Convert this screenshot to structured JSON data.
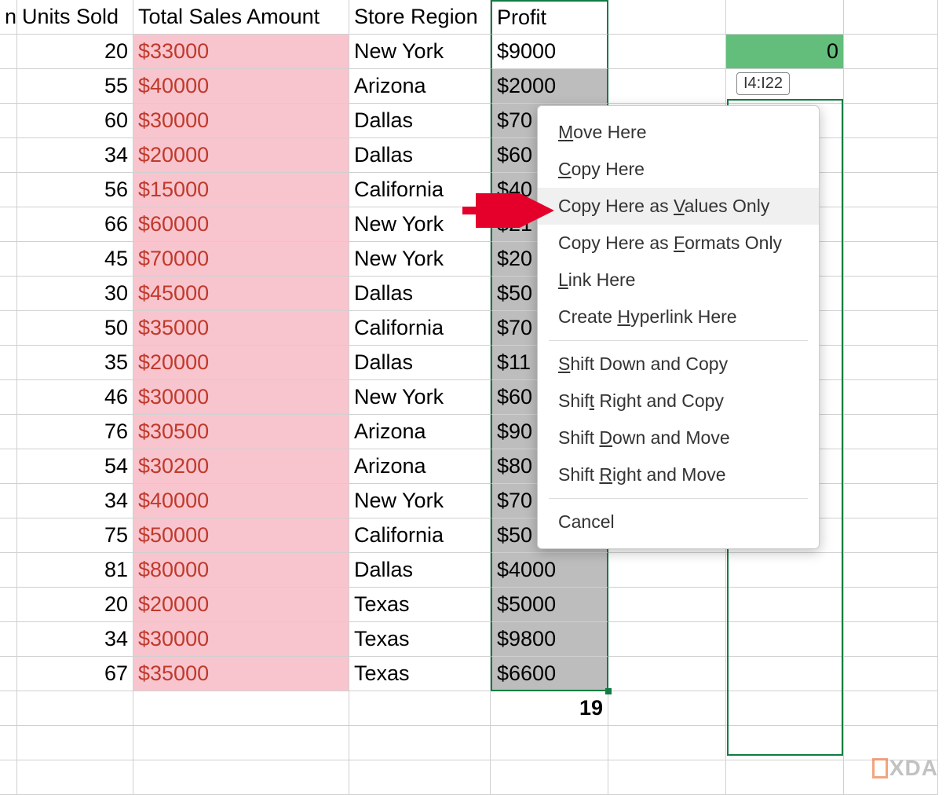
{
  "headers": {
    "partial": "n",
    "units_sold": "Units Sold",
    "total_sales": "Total Sales Amount",
    "store_region": "Store Region",
    "profit": "Profit"
  },
  "rows": [
    {
      "units": "20",
      "sales": "$33000",
      "region": "New York",
      "profit": "$9000"
    },
    {
      "units": "55",
      "sales": "$40000",
      "region": "Arizona",
      "profit": "$2000"
    },
    {
      "units": "60",
      "sales": "$30000",
      "region": "Dallas",
      "profit": "$70"
    },
    {
      "units": "34",
      "sales": "$20000",
      "region": "Dallas",
      "profit": "$60"
    },
    {
      "units": "56",
      "sales": "$15000",
      "region": "California",
      "profit": "$40"
    },
    {
      "units": "66",
      "sales": "$60000",
      "region": "New York",
      "profit": "$21"
    },
    {
      "units": "45",
      "sales": "$70000",
      "region": "New York",
      "profit": "$20"
    },
    {
      "units": "30",
      "sales": "$45000",
      "region": "Dallas",
      "profit": "$50"
    },
    {
      "units": "50",
      "sales": "$35000",
      "region": "California",
      "profit": "$70"
    },
    {
      "units": "35",
      "sales": "$20000",
      "region": "Dallas",
      "profit": "$11"
    },
    {
      "units": "46",
      "sales": "$30000",
      "region": "New York",
      "profit": "$60"
    },
    {
      "units": "76",
      "sales": "$30500",
      "region": "Arizona",
      "profit": "$90"
    },
    {
      "units": "54",
      "sales": "$30200",
      "region": "Arizona",
      "profit": "$80"
    },
    {
      "units": "34",
      "sales": "$40000",
      "region": "New York",
      "profit": "$70"
    },
    {
      "units": "75",
      "sales": "$50000",
      "region": "California",
      "profit": "$50"
    },
    {
      "units": "81",
      "sales": "$80000",
      "region": "Dallas",
      "profit": "$4000"
    },
    {
      "units": "20",
      "sales": "$20000",
      "region": "Texas",
      "profit": "$5000"
    },
    {
      "units": "34",
      "sales": "$30000",
      "region": "Texas",
      "profit": "$9800"
    },
    {
      "units": "67",
      "sales": "$35000",
      "region": "Texas",
      "profit": "$6600"
    }
  ],
  "dest_first_cell": "0",
  "count_cell": "19",
  "ref_tooltip": "I4:I22",
  "context_menu": {
    "move_here": "Move Here",
    "copy_here": "Copy Here",
    "copy_values": "Copy Here as Values Only",
    "copy_formats": "Copy Here as Formats Only",
    "link_here": "Link Here",
    "create_hyperlink": "Create Hyperlink Here",
    "shift_down_copy": "Shift Down and Copy",
    "shift_right_copy": "Shift Right and Copy",
    "shift_down_move": "Shift Down and Move",
    "shift_right_move": "Shift Right and Move",
    "cancel": "Cancel"
  },
  "logo_text": "XDA"
}
